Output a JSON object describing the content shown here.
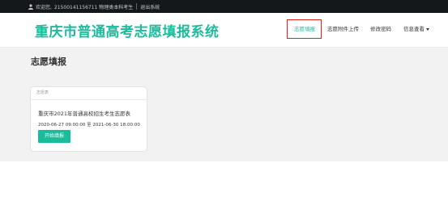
{
  "topbar": {
    "welcome": "欢迎您,",
    "user_info": "21500141156711 物理类本科考生",
    "logout": "退出系统"
  },
  "header": {
    "brand": "重庆市普通高考志愿填报系统",
    "nav": [
      {
        "label": "志愿填报",
        "active": true
      },
      {
        "label": "志愿附件上传",
        "active": false
      },
      {
        "label": "修改密码",
        "active": false
      },
      {
        "label": "信息查看",
        "active": false,
        "dropdown": true
      }
    ]
  },
  "main": {
    "title": "志愿填报",
    "card": {
      "header": "志愿表",
      "title": "重庆市2021年普通高校招生考生志愿表",
      "time_range": "2020-06-27 09:00:00 至 2021-06-30 18:00:00",
      "button": "开始填报"
    }
  },
  "colors": {
    "accent": "#1abc9c",
    "topbar_bg": "#15181b",
    "highlight_border": "#e0201a"
  },
  "icons": {
    "user": "user-icon",
    "dropdown": "caret-down-icon"
  }
}
